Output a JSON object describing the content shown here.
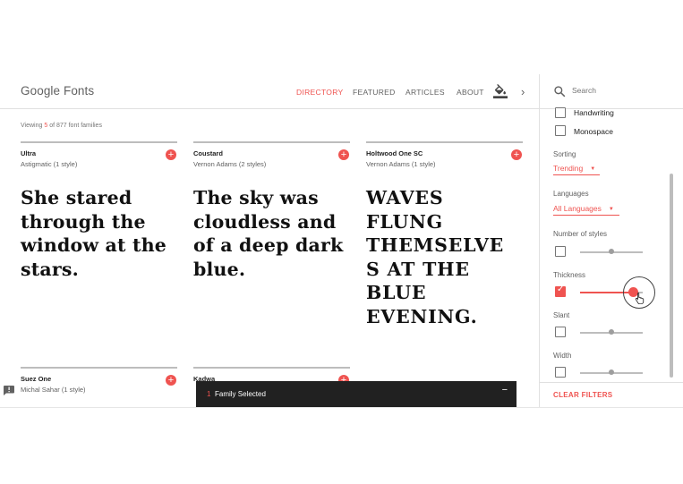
{
  "header": {
    "logo": "Google Fonts",
    "nav": [
      {
        "label": "DIRECTORY",
        "active": true
      },
      {
        "label": "FEATURED",
        "active": false
      },
      {
        "label": "ARTICLES",
        "active": false
      },
      {
        "label": "ABOUT",
        "active": false
      }
    ],
    "icons": [
      "paint-bucket-icon",
      "chevron-right-icon"
    ],
    "chevron": "›"
  },
  "content": {
    "viewing_prefix": "Viewing ",
    "viewing_count": "5",
    "viewing_suffix": " of 877 font families",
    "cards": [
      {
        "name": "Ultra",
        "meta": "Astigmatic (1 style)",
        "sample": "She stared through the window at the stars.",
        "add_symbol": "+"
      },
      {
        "name": "Coustard",
        "meta": "Vernon Adams (2 styles)",
        "sample": "The sky was cloudless and of a deep dark blue.",
        "add_symbol": "+"
      },
      {
        "name": "Holtwood One SC",
        "meta": "Vernon Adams (1 style)",
        "sample": "WAVES FLUNG THEMSELVE S AT THE BLUE EVENING.",
        "add_symbol": "+"
      },
      {
        "name": "Suez One",
        "meta": "Michal Sahar (1 style)",
        "add_symbol": "+"
      },
      {
        "name": "Kadwa",
        "add_symbol": "+"
      }
    ]
  },
  "sidebar": {
    "search_placeholder": "Search",
    "categories": [
      {
        "label": "Handwriting",
        "checked": false
      },
      {
        "label": "Monospace",
        "checked": false
      }
    ],
    "sorting": {
      "label": "Sorting",
      "value": "Trending"
    },
    "languages": {
      "label": "Languages",
      "value": "All Languages"
    },
    "filters": [
      {
        "label": "Number of styles",
        "enabled": false,
        "level": 0.5
      },
      {
        "label": "Thickness",
        "enabled": true,
        "level": 0.9
      },
      {
        "label": "Slant",
        "enabled": false,
        "level": 0.5
      },
      {
        "label": "Width",
        "enabled": false,
        "level": 0.5
      }
    ],
    "clear_filters": "CLEAR FILTERS"
  },
  "snackbar": {
    "count": "1",
    "text": "Family Selected",
    "minimize": "−"
  },
  "colors": {
    "accent": "#ef5350",
    "text": "#212121",
    "muted": "#616161",
    "snackbar_bg": "#212121"
  }
}
